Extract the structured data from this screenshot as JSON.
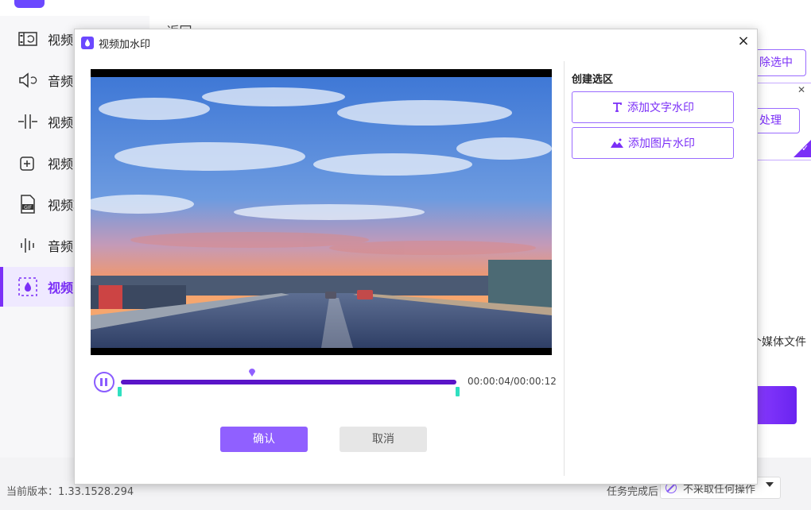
{
  "app": {
    "sidebar": {
      "items": [
        {
          "label": "视频",
          "icon": "video-convert-icon"
        },
        {
          "label": "音频",
          "icon": "audio-convert-icon"
        },
        {
          "label": "视频",
          "icon": "video-split-icon"
        },
        {
          "label": "视频",
          "icon": "video-merge-icon"
        },
        {
          "label": "视频转",
          "icon": "gif-icon"
        },
        {
          "label": "音频",
          "icon": "audio-wave-icon"
        },
        {
          "label": "视频",
          "icon": "watermark-icon",
          "active": true
        }
      ]
    },
    "main": {
      "back_label": "返回",
      "clear_selected_label": "除选中",
      "process_label": "处理",
      "media_files_text": "个媒体文件"
    },
    "footer": {
      "version_text": "当前版本：1.33.1528.294",
      "after_task_label": "任务完成后",
      "after_task_value": "不采取任何操作"
    }
  },
  "dialog": {
    "title": "视频加水印",
    "close_glyph": "×",
    "timecode": "00:00:04/00:00:12",
    "progress": 0.39,
    "confirm_label": "确认",
    "cancel_label": "取消",
    "create_selection_title": "创建选区",
    "add_text_watermark_label": "添加文字水印",
    "add_image_watermark_label": "添加图片水印"
  },
  "colors": {
    "accent": "#7b2ff7",
    "confirm": "#9060ff",
    "range_marker": "#2fe0c0"
  }
}
